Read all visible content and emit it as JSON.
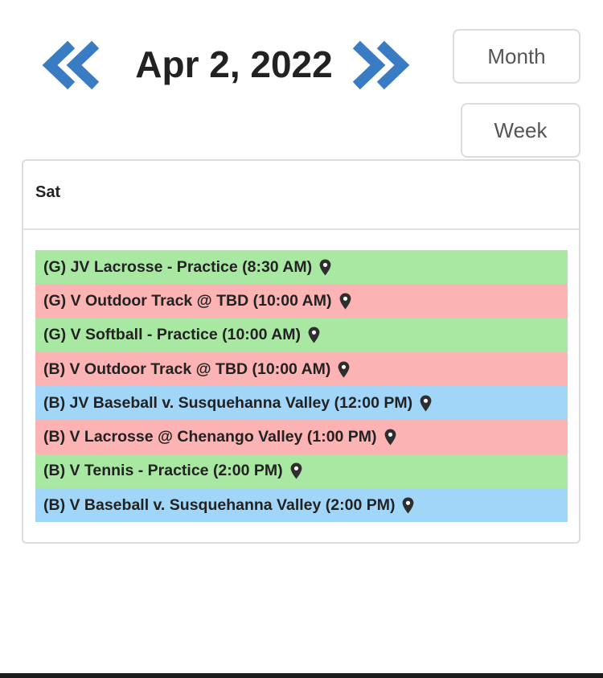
{
  "header": {
    "date": "Apr 2, 2022",
    "prev_icon": "double-chevron-left-icon",
    "next_icon": "double-chevron-right-icon",
    "accent_color": "#3a7cc4"
  },
  "views": {
    "month_label": "Month",
    "week_label": "Week"
  },
  "calendar": {
    "day_label": "Sat",
    "events": [
      {
        "text": "(G) JV Lacrosse - Practice (8:30 AM)",
        "color": "#a9e8a3",
        "icon": "map-pin-icon"
      },
      {
        "text": "(G) V Outdoor Track @ TBD (10:00 AM)",
        "color": "#fbb3b3",
        "icon": "map-pin-icon"
      },
      {
        "text": "(G) V Softball - Practice (10:00 AM)",
        "color": "#a9e8a3",
        "icon": "map-pin-icon"
      },
      {
        "text": "(B) V Outdoor Track @ TBD (10:00 AM)",
        "color": "#fbb3b3",
        "icon": "map-pin-icon"
      },
      {
        "text": "(B) JV Baseball v. Susquehanna Valley (12:00 PM)",
        "color": "#a1d6f8",
        "icon": "map-pin-icon"
      },
      {
        "text": "(B) V Lacrosse @ Chenango Valley (1:00 PM)",
        "color": "#fbb3b3",
        "icon": "map-pin-icon"
      },
      {
        "text": "(B) V Tennis - Practice (2:00 PM)",
        "color": "#a9e8a3",
        "icon": "map-pin-icon"
      },
      {
        "text": "(B) V Baseball v. Susquehanna Valley (2:00 PM)",
        "color": "#a1d6f8",
        "icon": "map-pin-icon"
      }
    ]
  }
}
